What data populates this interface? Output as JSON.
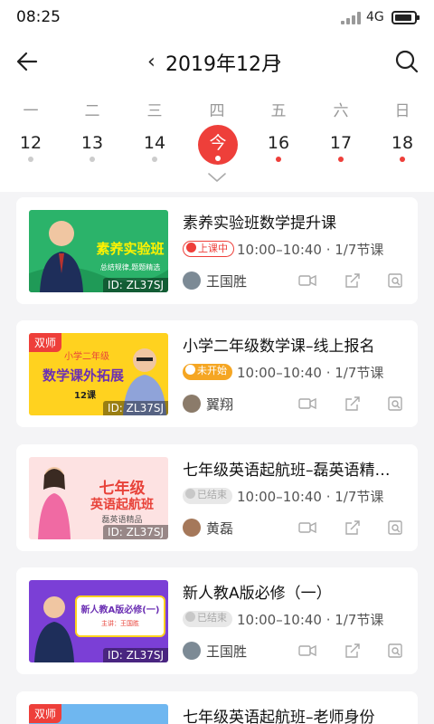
{
  "status_bar": {
    "time": "08:25",
    "network": "4G"
  },
  "header": {
    "prev_glyph": "‹",
    "next_glyph": "›",
    "month_title": "2019年12月"
  },
  "calendar": {
    "weekdays": [
      "一",
      "二",
      "三",
      "四",
      "五",
      "六",
      "日"
    ],
    "dates": [
      "12",
      "13",
      "14",
      "今",
      "16",
      "17",
      "18"
    ],
    "dot_colors": [
      "#cccccc",
      "#cccccc",
      "#cccccc",
      "#ffffff",
      "#ee3f3a",
      "#ee3f3a",
      "#ee3f3a"
    ],
    "selected_index": 3
  },
  "courses": [
    {
      "title": "素养实验班数学提升课",
      "status": "上课中",
      "time": "10:00–10:40 · 1/7节课",
      "teacher": "王国胜",
      "badge": "",
      "id": "ID: ZL37SJ",
      "thumb_text": "素养实验班",
      "thumb_sub": "总结规律,题题精选"
    },
    {
      "title": "小学二年级数学课–线上报名",
      "status": "未开始",
      "time": "10:00–10:40 · 1/7节课",
      "teacher": "翼翔",
      "badge": "双师",
      "id": "ID: ZL37SJ",
      "thumb_text": "数学课外拓展",
      "thumb_top": "小学二年级",
      "thumb_sub": "12课"
    },
    {
      "title": "七年级英语起航班–磊英语精…",
      "status": "已结束",
      "time": "10:00–10:40 · 1/7节课",
      "teacher": "黄磊",
      "badge": "",
      "id": "ID: ZL37SJ",
      "thumb_text": "七年级",
      "thumb_text2": "英语起航班",
      "thumb_sub": "磊英语精品"
    },
    {
      "title": "新人教A版必修（一）",
      "status": "已结束",
      "time": "10:00–10:40 · 1/7节课",
      "teacher": "王国胜",
      "badge": "",
      "id": "ID: ZL37SJ",
      "thumb_text": "新人教A版必修(一)",
      "thumb_sub": "主讲：王国胜"
    },
    {
      "title": "七年级英语起航班–老师身份",
      "badge": "双师"
    }
  ],
  "colors": {
    "accent": "#ee3f3a",
    "waiting": "#f5a623",
    "ended": "#aaaaaa"
  },
  "icons": [
    "back-arrow-icon",
    "search-icon",
    "chevron-down-icon",
    "video-icon",
    "share-icon",
    "search-doc-icon"
  ]
}
